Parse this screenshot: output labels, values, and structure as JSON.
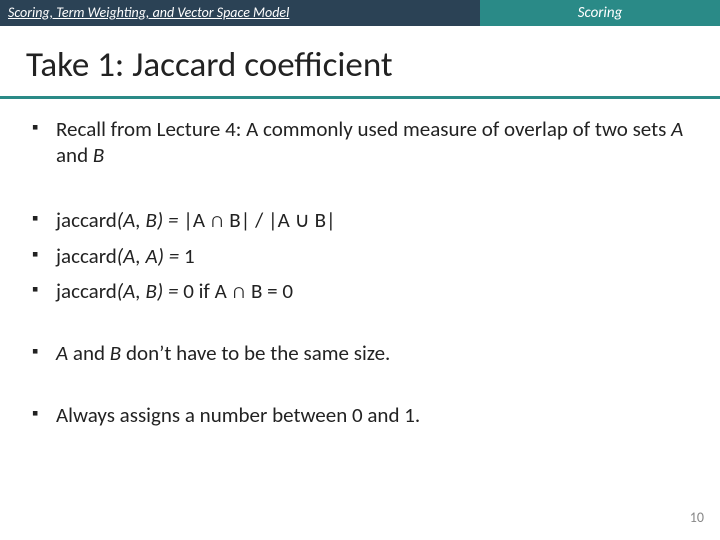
{
  "header": {
    "left": "Scoring, Term Weighting, and Vector Space Model",
    "right": "Scoring"
  },
  "title": "Take 1: Jaccard coefficient",
  "bullets": {
    "b1_pre": "Recall from Lecture 4: A commonly used measure of overlap of two sets ",
    "b1_a": "A",
    "b1_mid": " and ",
    "b1_b": "B",
    "b2_label": "jaccard",
    "b2_args": "(A, B) = ",
    "b2_formula": "|A ∩ B| / |A ∪ B|",
    "b3_label": "jaccard",
    "b3_args": "(A, A) = ",
    "b3_val": "1",
    "b4_label": "jaccard",
    "b4_args": "(A, B) = ",
    "b4_val": "0 if A ∩ B = 0",
    "b5_a": "A",
    "b5_mid1": " and ",
    "b5_b": "B",
    "b5_rest": " don’t have to be the same size.",
    "b6": "Always assigns a number between 0 and 1."
  },
  "page_number": "10"
}
